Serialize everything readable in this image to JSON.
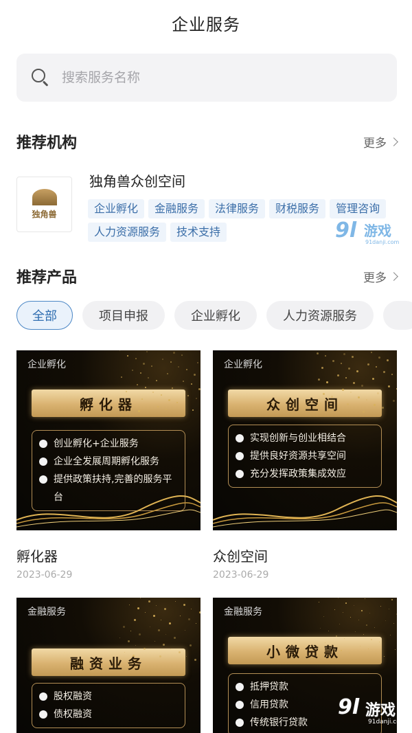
{
  "header": {
    "title": "企业服务"
  },
  "search": {
    "placeholder": "搜索服务名称"
  },
  "recommended_org": {
    "heading": "推荐机构",
    "more": "更多",
    "org": {
      "name": "独角兽众创空间",
      "logo_text": "独角兽",
      "tags": [
        "企业孵化",
        "金融服务",
        "法律服务",
        "财税服务",
        "管理咨询",
        "人力资源服务",
        "技术支持"
      ]
    }
  },
  "recommended_products": {
    "heading": "推荐产品",
    "more": "更多",
    "filters": [
      "全部",
      "项目申报",
      "企业孵化",
      "人力资源服务"
    ],
    "active_filter": "全部",
    "cards": [
      {
        "category": "企业孵化",
        "banner": "孵化器",
        "bullets": [
          "创业孵化+企业服务",
          "企业全发展周期孵化服务",
          "提供政策扶持,完善的服务平台"
        ],
        "title": "孵化器",
        "date": "2023-06-29"
      },
      {
        "category": "企业孵化",
        "banner": "众创空间",
        "bullets": [
          "实现创新与创业相结合",
          "提供良好资源共享空间",
          "充分发挥政策集成效应"
        ],
        "title": "众创空间",
        "date": "2023-06-29"
      },
      {
        "category": "金融服务",
        "banner": "融资业务",
        "bullets": [
          "股权融资",
          "债权融资"
        ]
      },
      {
        "category": "金融服务",
        "banner": "小微贷款",
        "bullets": [
          "抵押贷款",
          "信用贷款",
          "传统银行贷款"
        ]
      }
    ]
  },
  "watermark": {
    "number": "9l",
    "text": "游戏",
    "url": "91danji.com"
  },
  "colors": {
    "accent": "#4a86c5",
    "tag_bg": "#eef4fb",
    "gold": "#d9b270"
  }
}
